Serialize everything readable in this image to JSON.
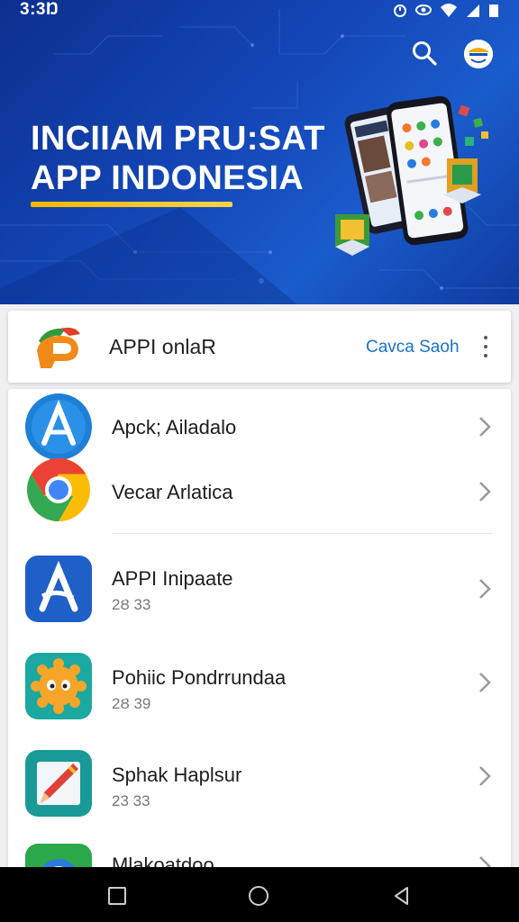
{
  "status_bar": {
    "time": "3:3Ŋ"
  },
  "hero": {
    "title": "INCIIAM PRU:SAT\nAPP INDONESIA",
    "colors": {
      "background": "#1447b8",
      "underline": "#f5b800"
    }
  },
  "header": {
    "title": "APPI onlaR",
    "action_label": "Cavca Saoh"
  },
  "apps": [
    {
      "name": "Apck; Ailadalo",
      "version": "",
      "icon": "app-store-circle-icon"
    },
    {
      "name": "Vecar Arlatica",
      "version": "",
      "icon": "chrome-icon"
    },
    {
      "name": "APPI Inipaate",
      "version": "2Ȣ 33",
      "icon": "letter-a-icon"
    },
    {
      "name": "Pohiic Pondrrundaa",
      "version": "2Ȣ 39",
      "icon": "gear-face-icon"
    },
    {
      "name": "Sphak Haplsur",
      "version": "23 33",
      "icon": "pencil-icon"
    },
    {
      "name": "Mlakoatdoo",
      "version": "",
      "icon": "green-circle-icon"
    }
  ],
  "nav": {
    "icons": [
      "recents-square-icon",
      "home-circle-icon",
      "back-triangle-icon"
    ]
  }
}
